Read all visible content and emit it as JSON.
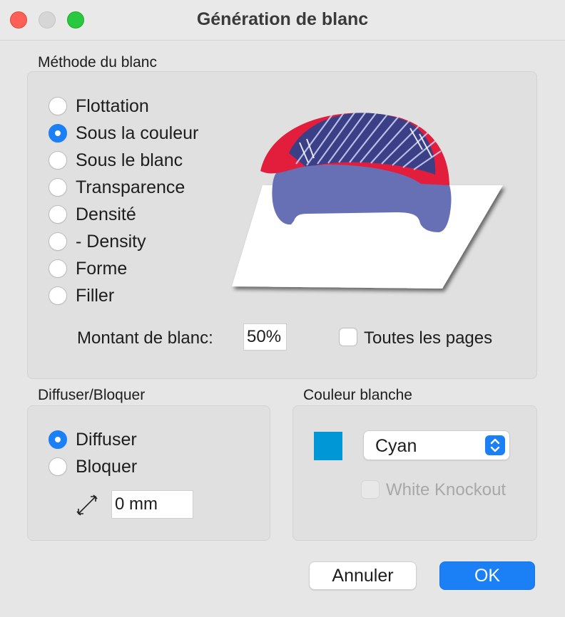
{
  "window": {
    "title": "Génération de blanc"
  },
  "method_section": {
    "label": "Méthode du blanc",
    "options": [
      {
        "label": "Flottation",
        "selected": false
      },
      {
        "label": "Sous la couleur",
        "selected": true
      },
      {
        "label": "Sous le blanc",
        "selected": false
      },
      {
        "label": "Transparence",
        "selected": false
      },
      {
        "label": "Densité",
        "selected": false
      },
      {
        "label": "- Density",
        "selected": false
      },
      {
        "label": "Forme",
        "selected": false
      },
      {
        "label": "Filler",
        "selected": false
      }
    ],
    "amount_label": "Montant de blanc:",
    "amount_value": "50%",
    "all_pages_label": "Toutes les pages",
    "all_pages_checked": false
  },
  "diffuse_section": {
    "label": "Diffuser/Bloquer",
    "options": [
      {
        "label": "Diffuser",
        "selected": true
      },
      {
        "label": "Bloquer",
        "selected": false
      }
    ],
    "distance_value": "0 mm",
    "distance_icon": "resize-diagonal-icon"
  },
  "color_section": {
    "label": "Couleur blanche",
    "swatch_color": "#0097d6",
    "selected_color": "Cyan",
    "knockout_label": "White Knockout",
    "knockout_enabled": false
  },
  "buttons": {
    "cancel": "Annuler",
    "ok": "OK"
  },
  "colors": {
    "accent": "#1b7ff5",
    "preview_ink": "#6770b4",
    "preview_red": "#e21e3c"
  }
}
